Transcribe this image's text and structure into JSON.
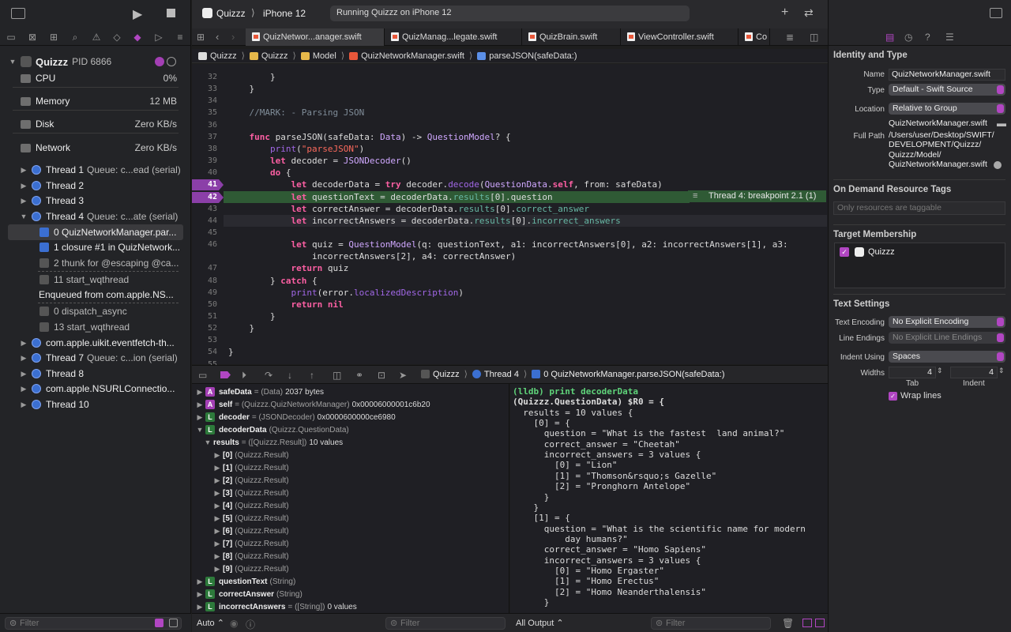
{
  "toolbar": {
    "scheme": "Quizzz",
    "device": "iPhone 12",
    "status": "Running Quizzz on iPhone 12"
  },
  "debug_nav": {
    "process": "Quizzz",
    "pid": "PID 6866",
    "gauges": [
      {
        "label": "CPU",
        "value": "0%"
      },
      {
        "label": "Memory",
        "value": "12 MB"
      },
      {
        "label": "Disk",
        "value": "Zero KB/s"
      },
      {
        "label": "Network",
        "value": "Zero KB/s"
      }
    ],
    "threads": [
      {
        "label": "Thread 1",
        "queue": "Queue: c...ead (serial)"
      },
      {
        "label": "Thread 2",
        "queue": ""
      },
      {
        "label": "Thread 3",
        "queue": ""
      },
      {
        "label": "Thread 4",
        "queue": "Queue: c...ate (serial)"
      }
    ],
    "frames": [
      "0 QuizNetworkManager.par...",
      "1 closure #1 in QuizNetwork...",
      "2 thunk for @escaping @ca...",
      "11 start_wqthread",
      "Enqueued from com.apple.NS...",
      "0 dispatch_async",
      "13 start_wqthread"
    ],
    "threads_after": [
      {
        "label": "com.apple.uikit.eventfetch-th...",
        "queue": ""
      },
      {
        "label": "Thread 7",
        "queue": "Queue: c...ion (serial)"
      },
      {
        "label": "Thread 8",
        "queue": ""
      },
      {
        "label": "com.apple.NSURLConnectio...",
        "queue": ""
      },
      {
        "label": "Thread 10",
        "queue": ""
      }
    ],
    "filter_placeholder": "Filter"
  },
  "tabs": [
    "QuizNetwor...anager.swift",
    "QuizManag...legate.swift",
    "QuizBrain.swift",
    "ViewController.swift",
    "Co"
  ],
  "breadcrumb": [
    "Quizzz",
    "Quizzz",
    "Model",
    "QuizNetworkManager.swift",
    "parseJSON(safeData:)"
  ],
  "code_lines": [
    {
      "n": "32",
      "t": "        }"
    },
    {
      "n": "33",
      "t": "    }"
    },
    {
      "n": "34",
      "t": ""
    },
    {
      "n": "35",
      "t": "    //MARK: - Parsing JSON"
    },
    {
      "n": "36",
      "t": ""
    },
    {
      "n": "37",
      "t": "    func parseJSON(safeData: Data) -> QuestionModel? {"
    },
    {
      "n": "38",
      "t": "        print(\"parseJSON\")"
    },
    {
      "n": "39",
      "t": "        let decoder = JSONDecoder()"
    },
    {
      "n": "40",
      "t": "        do {"
    },
    {
      "n": "41",
      "t": "            let decoderData = try decoder.decode(QuestionData.self, from: safeData)"
    },
    {
      "n": "42",
      "t": "            let questionText = decoderData.results[0].question"
    },
    {
      "n": "43",
      "t": "            let correctAnswer = decoderData.results[0].correct_answer"
    },
    {
      "n": "44",
      "t": "            let incorrectAnswers = decoderData.results[0].incorrect_answers"
    },
    {
      "n": "45",
      "t": ""
    },
    {
      "n": "46",
      "t": "            let quiz = QuestionModel(q: questionText, a1: incorrectAnswers[0], a2: incorrectAnswers[1], a3:"
    },
    {
      "n": "",
      "t": "                incorrectAnswers[2], a4: correctAnswer)"
    },
    {
      "n": "47",
      "t": "            return quiz"
    },
    {
      "n": "48",
      "t": "        } catch {"
    },
    {
      "n": "49",
      "t": "            print(error.localizedDescription)"
    },
    {
      "n": "50",
      "t": "            return nil"
    },
    {
      "n": "51",
      "t": "        }"
    },
    {
      "n": "52",
      "t": "    }"
    },
    {
      "n": "53",
      "t": ""
    },
    {
      "n": "54",
      "t": "}"
    },
    {
      "n": "55",
      "t": ""
    }
  ],
  "breakpoint_label": "Thread 4: breakpoint 2.1 (1)",
  "debug_bar": {
    "crumbs": [
      "Quizzz",
      "Thread 4",
      "0 QuizNetworkManager.parseJSON(safeData:)"
    ]
  },
  "variables": [
    {
      "badge": "A",
      "name": "safeData",
      "type": "= (Data)",
      "value": "2037 bytes"
    },
    {
      "badge": "A",
      "name": "self",
      "type": "= (Quizzz.QuizNetworkManager)",
      "value": "0x00006000001c6b20"
    },
    {
      "badge": "L",
      "name": "decoder",
      "type": "= (JSONDecoder)",
      "value": "0x0000600000ce6980"
    },
    {
      "badge": "L",
      "name": "decoderData",
      "type": "(Quizzz.QuestionData)",
      "value": ""
    },
    {
      "badge": "",
      "name": "results",
      "type": "= ([Quizzz.Result])",
      "value": "10 values"
    },
    {
      "badge": "",
      "name": "[0]",
      "type": "(Quizzz.Result)",
      "value": ""
    },
    {
      "badge": "",
      "name": "[1]",
      "type": "(Quizzz.Result)",
      "value": ""
    },
    {
      "badge": "",
      "name": "[2]",
      "type": "(Quizzz.Result)",
      "value": ""
    },
    {
      "badge": "",
      "name": "[3]",
      "type": "(Quizzz.Result)",
      "value": ""
    },
    {
      "badge": "",
      "name": "[4]",
      "type": "(Quizzz.Result)",
      "value": ""
    },
    {
      "badge": "",
      "name": "[5]",
      "type": "(Quizzz.Result)",
      "value": ""
    },
    {
      "badge": "",
      "name": "[6]",
      "type": "(Quizzz.Result)",
      "value": ""
    },
    {
      "badge": "",
      "name": "[7]",
      "type": "(Quizzz.Result)",
      "value": ""
    },
    {
      "badge": "",
      "name": "[8]",
      "type": "(Quizzz.Result)",
      "value": ""
    },
    {
      "badge": "",
      "name": "[9]",
      "type": "(Quizzz.Result)",
      "value": ""
    },
    {
      "badge": "L",
      "name": "questionText",
      "type": "(String)",
      "value": ""
    },
    {
      "badge": "L",
      "name": "correctAnswer",
      "type": "(String)",
      "value": ""
    },
    {
      "badge": "L",
      "name": "incorrectAnswers",
      "type": "= ([String])",
      "value": "0 values"
    }
  ],
  "console_lines": [
    "(lldb) print decoderData",
    "(Quizzz.QuestionData) $R0 = {",
    "  results = 10 values {",
    "    [0] = {",
    "      question = \"What is the fastest  land animal?\"",
    "      correct_answer = \"Cheetah\"",
    "      incorrect_answers = 3 values {",
    "        [0] = \"Lion\"",
    "        [1] = \"Thomson&rsquo;s Gazelle\"",
    "        [2] = \"Pronghorn Antelope\"",
    "      }",
    "    }",
    "    [1] = {",
    "      question = \"What is the scientific name for modern",
    "          day humans?\"",
    "      correct_answer = \"Homo Sapiens\"",
    "      incorrect_answers = 3 values {",
    "        [0] = \"Homo Ergaster\"",
    "        [1] = \"Homo Erectus\"",
    "        [2] = \"Homo Neanderthalensis\"",
    "      }"
  ],
  "bottom": {
    "auto": "Auto",
    "filter": "Filter",
    "all_output": "All Output",
    "console_filter": "Filter"
  },
  "inspector": {
    "identity_title": "Identity and Type",
    "name_label": "Name",
    "name_value": "QuizNetworkManager.swift",
    "type_label": "Type",
    "type_value": "Default - Swift Source",
    "location_label": "Location",
    "location_value": "Relative to Group",
    "location_file": "QuizNetworkManager.swift",
    "fullpath_label": "Full Path",
    "fullpath_lines": [
      "/Users/user/Desktop/SWIFT/",
      "DEVELOPMENT/Quizzz/",
      "Quizzz/Model/",
      "QuizNetworkManager.swift"
    ],
    "odr_title": "On Demand Resource Tags",
    "odr_placeholder": "Only resources are taggable",
    "target_title": "Target Membership",
    "target_name": "Quizzz",
    "text_title": "Text Settings",
    "encoding_label": "Text Encoding",
    "encoding_value": "No Explicit Encoding",
    "endings_label": "Line Endings",
    "endings_value": "No Explicit Line Endings",
    "indent_label": "Indent Using",
    "indent_value": "Spaces",
    "widths_label": "Widths",
    "tab_value": "4",
    "indent_width_value": "4",
    "tab_label": "Tab",
    "indent_sub_label": "Indent",
    "wrap_label": "Wrap lines"
  },
  "colors": {
    "accent": "#b146c2",
    "breakpoint": "#8b3fa8",
    "current_line": "#2f5a35"
  }
}
